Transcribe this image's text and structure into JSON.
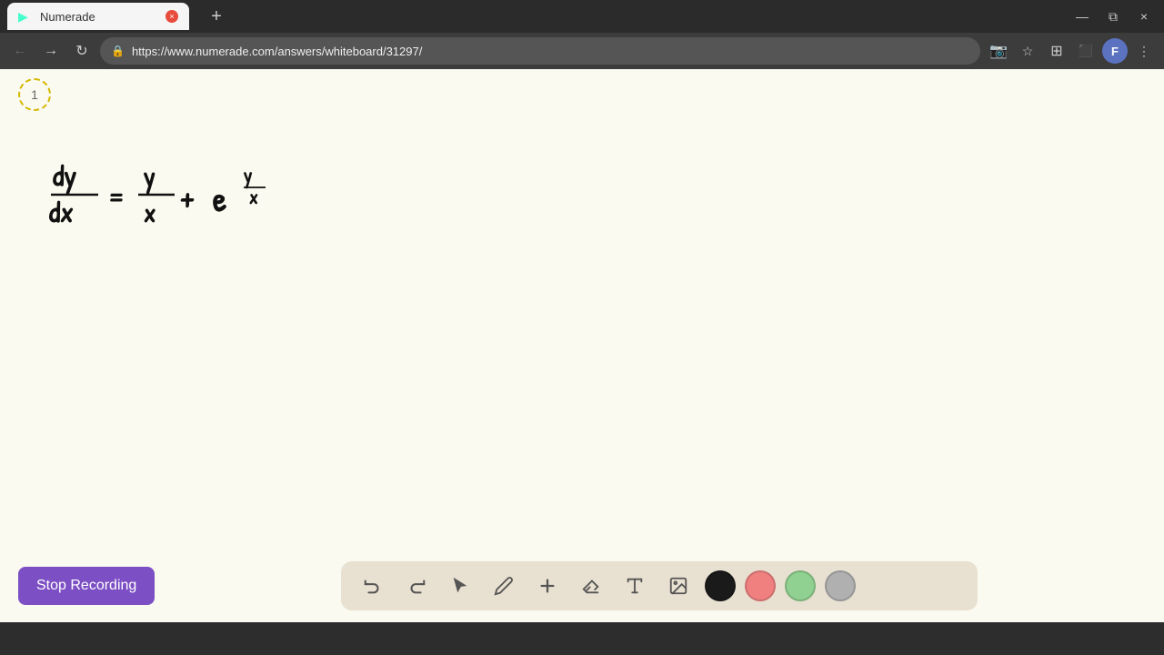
{
  "browser": {
    "tab": {
      "favicon": "▶",
      "title": "Numerade",
      "close_label": "×"
    },
    "new_tab_label": "+",
    "nav": {
      "back_label": "←",
      "forward_label": "→",
      "refresh_label": "↻",
      "url": "https://www.numerade.com/answers/whiteboard/31297/",
      "bookmark_label": "☆",
      "cast_label": "⬜",
      "extensions_label": "⊞",
      "profile_label": "F",
      "more_label": "⋮",
      "camera_label": "📷"
    },
    "window_controls": {
      "minimize": "—",
      "maximize": "⧉",
      "close": "×"
    }
  },
  "page": {
    "step_number": "1",
    "formula": {
      "description": "dy/dx = y/x + e^(y/x)"
    }
  },
  "toolbar": {
    "undo_label": "↺",
    "redo_label": "↻",
    "select_label": "▲",
    "pen_label": "✏",
    "add_label": "+",
    "eraser_label": "/",
    "text_label": "A",
    "image_label": "🖼",
    "colors": [
      {
        "name": "black",
        "value": "#1a1a1a"
      },
      {
        "name": "pink",
        "value": "#f08080"
      },
      {
        "name": "green",
        "value": "#90d090"
      },
      {
        "name": "gray",
        "value": "#b0b0b0"
      }
    ]
  },
  "bottom_bar": {
    "stop_recording_label": "Stop Recording"
  }
}
